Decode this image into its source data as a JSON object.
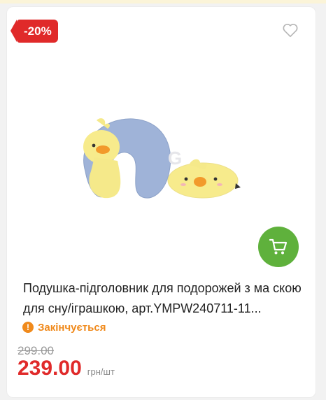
{
  "product": {
    "discount_badge": "-20%",
    "title": "Подушка-підголовник для подорожей з ма скою для сну/іграшкою, арт.YMPW240711-11...",
    "stock_status": "Закінчується",
    "old_price": "299.00",
    "price": "239.00",
    "unit": "грн/шт",
    "image_alt": "Подушка-підголовник та маска для сну у вигляді жовтого каченяти",
    "watermark": "G"
  },
  "icons": {
    "wishlist": "heart-icon",
    "cart": "cart-icon",
    "stock": "warning-icon"
  },
  "colors": {
    "discount": "#e02a2a",
    "price": "#e02a2a",
    "cart_button": "#5fb13c",
    "stock_warning": "#f08a1c",
    "old_price": "#9a9a9a"
  }
}
